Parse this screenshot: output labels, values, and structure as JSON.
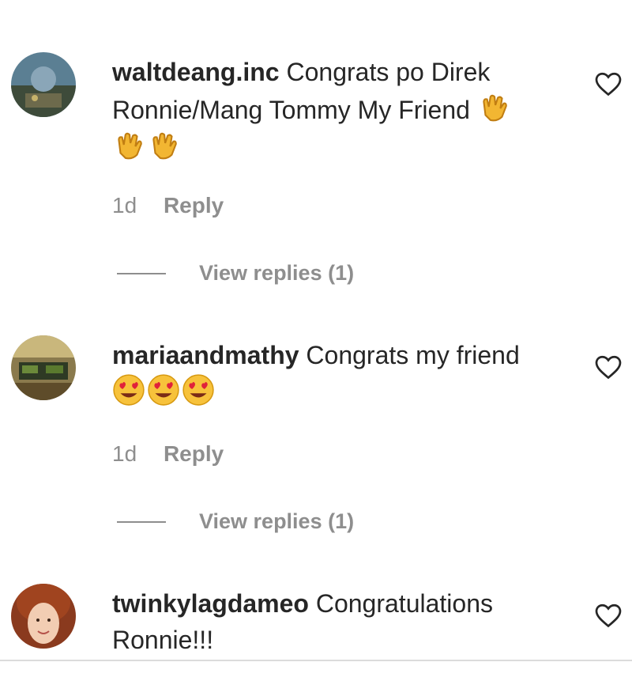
{
  "comments": [
    {
      "username": "waltdeang.inc",
      "text": "Congrats po Direk Ronnie/Mang Tommy My Friend",
      "emojis": [
        "clapping-hands",
        "clapping-hands",
        "clapping-hands"
      ],
      "time": "1d",
      "reply_label": "Reply",
      "view_replies": "View replies (1)"
    },
    {
      "username": "mariaandmathy",
      "text": "Congrats my friend",
      "emojis": [
        "heart-eyes",
        "heart-eyes",
        "heart-eyes"
      ],
      "time": "1d",
      "reply_label": "Reply",
      "view_replies": "View replies (1)"
    },
    {
      "username": "twinkylagdameo",
      "text": "Congratulations Ronnie!!!"
    }
  ],
  "colors": {
    "username": "#262626",
    "meta": "#8e8e8e",
    "divider": "#dbdbdb"
  },
  "icons": {
    "like": "heart-outline-icon"
  }
}
